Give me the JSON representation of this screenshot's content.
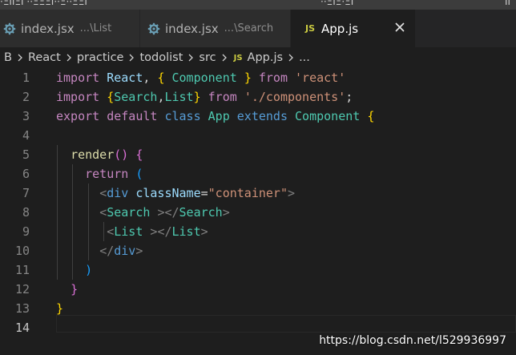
{
  "titlebar": {
    "fragments": [
      "·ΞΙΙΞΙ ··ΞΞΞΙ··Ξ··ΞΞΙ",
      "··ΞΙΞ·ΞΙ",
      "ΙΙ"
    ]
  },
  "tabs": [
    {
      "name": "index.jsx",
      "desc": "...\\List",
      "icon": "react-gear-icon",
      "active": false
    },
    {
      "name": "index.jsx",
      "desc": "...\\Search",
      "icon": "react-gear-icon",
      "active": false
    },
    {
      "name": "App.js",
      "desc": "",
      "icon": "JS",
      "active": true,
      "close_icon": "close-icon"
    }
  ],
  "breadcrumb": {
    "items": [
      "B",
      "React",
      "practice",
      "todolist",
      "src"
    ],
    "file_icon": "JS",
    "file": "App.js",
    "more": "..."
  },
  "code_lines": [
    {
      "n": "1",
      "text": "import React, { Component } from 'react'"
    },
    {
      "n": "2",
      "text": "import {Search,List} from './components';"
    },
    {
      "n": "3",
      "text": "export default class App extends Component {"
    },
    {
      "n": "4",
      "text": ""
    },
    {
      "n": "5",
      "text": "  render() {"
    },
    {
      "n": "6",
      "text": "    return ("
    },
    {
      "n": "7",
      "text": "      <div className=\"container\">"
    },
    {
      "n": "8",
      "text": "      <Search ></Search>"
    },
    {
      "n": "9",
      "text": "       <List ></List>"
    },
    {
      "n": "10",
      "text": "      </div>"
    },
    {
      "n": "11",
      "text": "    )"
    },
    {
      "n": "12",
      "text": "  }"
    },
    {
      "n": "13",
      "text": "}"
    },
    {
      "n": "14",
      "text": ""
    }
  ],
  "watermark": "https://blog.csdn.net/l529936997",
  "colors": {
    "editor_bg": "#1e1e1e",
    "keyword": "#c586c0",
    "storage": "#569cd6",
    "class": "#4ec9b0",
    "string": "#ce9178"
  }
}
